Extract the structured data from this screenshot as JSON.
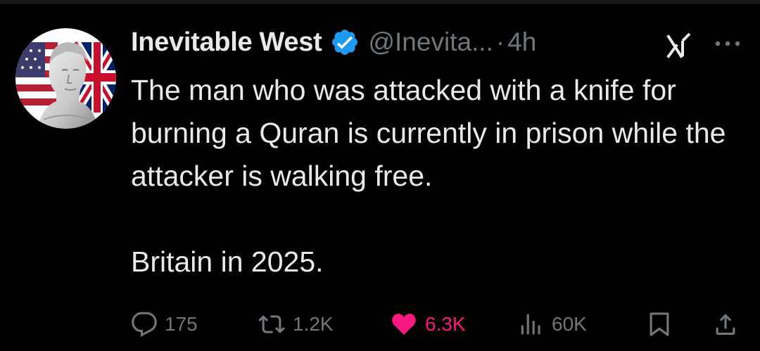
{
  "post": {
    "author": {
      "display_name": "Inevitable West",
      "handle": "@Inevita...",
      "verified": true,
      "avatar": "statue-bust-with-us-uk-flags"
    },
    "separator": "·",
    "time": "4h",
    "text": "The man who was attacked with a knife for burning a Quran is currently in prison while the attacker is walking free.\n\nBritain in 2025."
  },
  "actions": {
    "reply_count": "175",
    "repost_count": "1.2K",
    "like_count": "6.3K",
    "views_count": "60K"
  },
  "icons": {
    "verified": "verified-badge-icon",
    "grok": "grok-icon",
    "more": "more-icon",
    "reply": "reply-icon",
    "repost": "repost-icon",
    "like": "heart-icon",
    "views": "views-icon",
    "bookmark": "bookmark-icon",
    "share": "share-icon"
  },
  "colors": {
    "background": "#000000",
    "text": "#e7e9ea",
    "secondary": "#71767b",
    "verified_blue": "#1d9bf0",
    "like_pink": "#f91880"
  }
}
